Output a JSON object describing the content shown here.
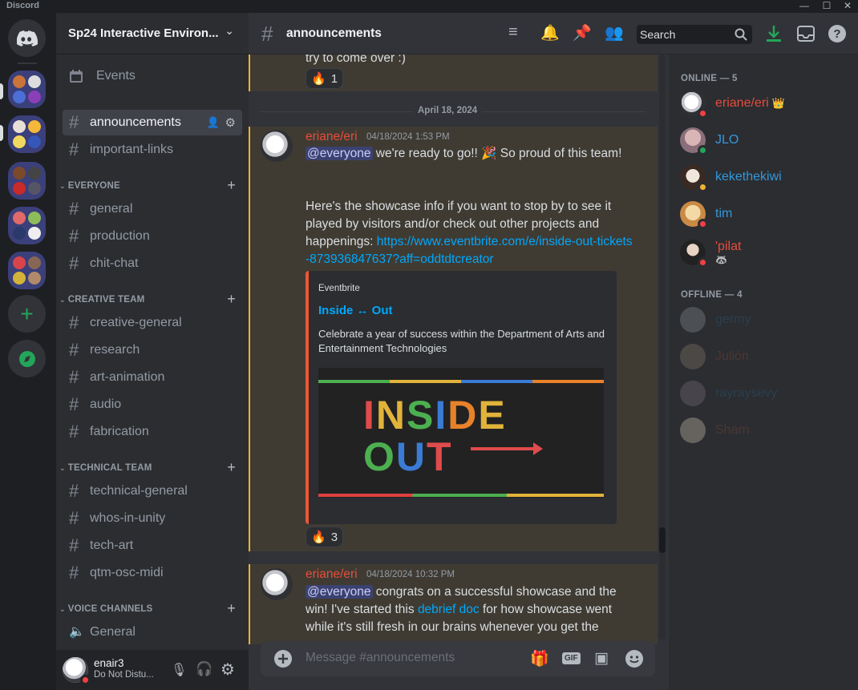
{
  "app": {
    "name": "Discord",
    "minimize": "—",
    "maximize": "☐",
    "close": "✕"
  },
  "server": {
    "name": "Sp24 Interactive Environ..."
  },
  "sidebar": {
    "events_label": "Events",
    "channels_top": [
      "announcements",
      "important-links"
    ],
    "categories": [
      {
        "name": "EVERYONE",
        "channels": [
          "general",
          "production",
          "chit-chat"
        ]
      },
      {
        "name": "CREATIVE TEAM",
        "channels": [
          "creative-general",
          "research",
          "art-animation",
          "audio",
          "fabrication"
        ]
      },
      {
        "name": "TECHNICAL TEAM",
        "channels": [
          "technical-general",
          "whos-in-unity",
          "tech-art",
          "qtm-osc-midi"
        ]
      },
      {
        "name": "VOICE CHANNELS",
        "channels": [
          "General"
        ]
      }
    ]
  },
  "user": {
    "name": "enair3",
    "status": "Do Not Distu..."
  },
  "header": {
    "channel": "announcements",
    "search_placeholder": "Search"
  },
  "messages": {
    "prev_tail": "try to come over :)",
    "prev_reaction": {
      "emoji": "🔥",
      "count": "1"
    },
    "date_divider": "April 18, 2024",
    "msg1": {
      "author": "eriane/eri",
      "time": "04/18/2024 1:53 PM",
      "mention": "@everyone",
      "line1": " we're ready to go!! 🎉 So proud of this team!",
      "para2": "Here's the showcase info if you want to stop by to see it played by visitors and/or check out other projects and happenings: ",
      "link": "https://www.eventbrite.com/e/inside-out-tickets-873936847637?aff=oddtdtcreator",
      "embed": {
        "provider": "Eventbrite",
        "title": "Inside ↔ Out",
        "description": "Celebrate a year of success within the Department of Arts and Entertainment Technologies",
        "image_word1": "INSIDE",
        "image_word2": "OUT"
      },
      "reaction": {
        "emoji": "🔥",
        "count": "3"
      }
    },
    "msg2": {
      "author": "eriane/eri",
      "time": "04/18/2024 10:32 PM",
      "mention": "@everyone",
      "text1": " congrats on a successful showcase and the win! I've started this ",
      "link": "debrief doc",
      "text2": " for how showcase went while it's still fresh in our brains whenever you get the"
    }
  },
  "composer": {
    "placeholder": "Message #announcements",
    "gif": "GIF"
  },
  "members": {
    "online_header": "ONLINE — 5",
    "offline_header": "OFFLINE — 4",
    "online": [
      {
        "name": "eriane/eri",
        "color": "#e74c3c",
        "status": "dnd",
        "badge": "👑"
      },
      {
        "name": "JLO",
        "color": "#3498db",
        "status": "online",
        "badge": ""
      },
      {
        "name": "kekethekiwi",
        "color": "#3498db",
        "status": "idle",
        "badge": ""
      },
      {
        "name": "tim",
        "color": "#3498db",
        "status": "dnd",
        "badge": ""
      },
      {
        "name": "'pilat",
        "color": "#e74c3c",
        "status": "dnd",
        "badge": "🦝"
      }
    ],
    "offline": [
      {
        "name": "germy",
        "color": "#2a5f86"
      },
      {
        "name": "Julión",
        "color": "#6b3a2c"
      },
      {
        "name": "rayraysevy",
        "color": "#2a5f86"
      },
      {
        "name": "Sharn",
        "color": "#6b3a2c"
      }
    ]
  }
}
